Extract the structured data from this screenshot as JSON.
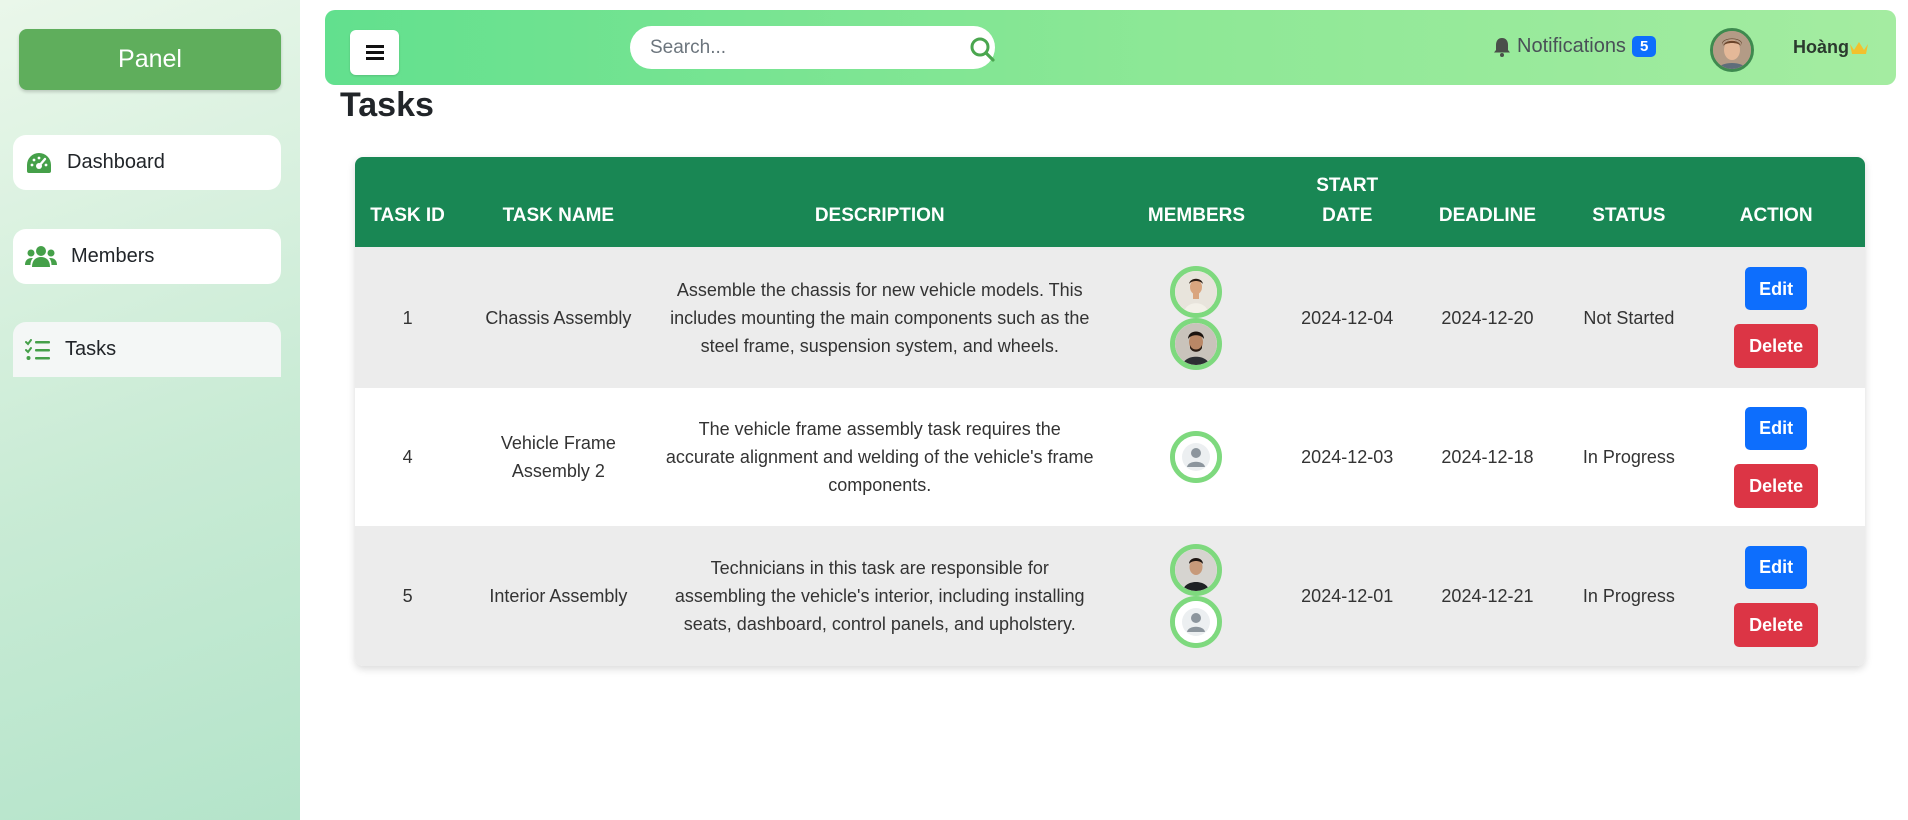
{
  "sidebar": {
    "brand": "Panel",
    "items": [
      {
        "label": "Dashboard",
        "icon": "speedometer-icon"
      },
      {
        "label": "Members",
        "icon": "users-icon"
      },
      {
        "label": "Tasks",
        "icon": "task-list-icon"
      }
    ]
  },
  "topbar": {
    "search_placeholder": "Search...",
    "notifications_label": "Notifications",
    "notifications_count": "5",
    "user_name": "Hoàng"
  },
  "page": {
    "title": "Tasks"
  },
  "table": {
    "headers": [
      "TASK ID",
      "TASK NAME",
      "DESCRIPTION",
      "MEMBERS",
      "START DATE",
      "DEADLINE",
      "STATUS",
      "ACTION"
    ],
    "rows": [
      {
        "id": "1",
        "name": "Chassis Assembly",
        "description": "Assemble the chassis for new vehicle models. This includes mounting the main components such as the steel frame, suspension system, and wheels.",
        "members": [
          "photo-avatar",
          "photo-avatar"
        ],
        "start": "2024-12-04",
        "deadline": "2024-12-20",
        "status": "Not Started",
        "edit": "Edit",
        "delete": "Delete"
      },
      {
        "id": "4",
        "name": "Vehicle Frame Assembly 2",
        "description": "The vehicle frame assembly task requires the accurate alignment and welding of the vehicle's frame components.",
        "members": [
          "default-avatar"
        ],
        "start": "2024-12-03",
        "deadline": "2024-12-18",
        "status": "In Progress",
        "edit": "Edit",
        "delete": "Delete"
      },
      {
        "id": "5",
        "name": "Interior Assembly",
        "description": "Technicians in this task are responsible for assembling the vehicle's interior, including installing seats, dashboard, control panels, and upholstery.",
        "members": [
          "photo-avatar",
          "default-avatar"
        ],
        "start": "2024-12-01",
        "deadline": "2024-12-21",
        "status": "In Progress",
        "edit": "Edit",
        "delete": "Delete"
      }
    ]
  },
  "colors": {
    "table_header": "#198754",
    "edit_button": "#0d6efd",
    "delete_button": "#dc3545",
    "brand_button": "#5fae5c",
    "topbar_gradient_start": "#62e08e",
    "topbar_gradient_end": "#a4eca1"
  }
}
